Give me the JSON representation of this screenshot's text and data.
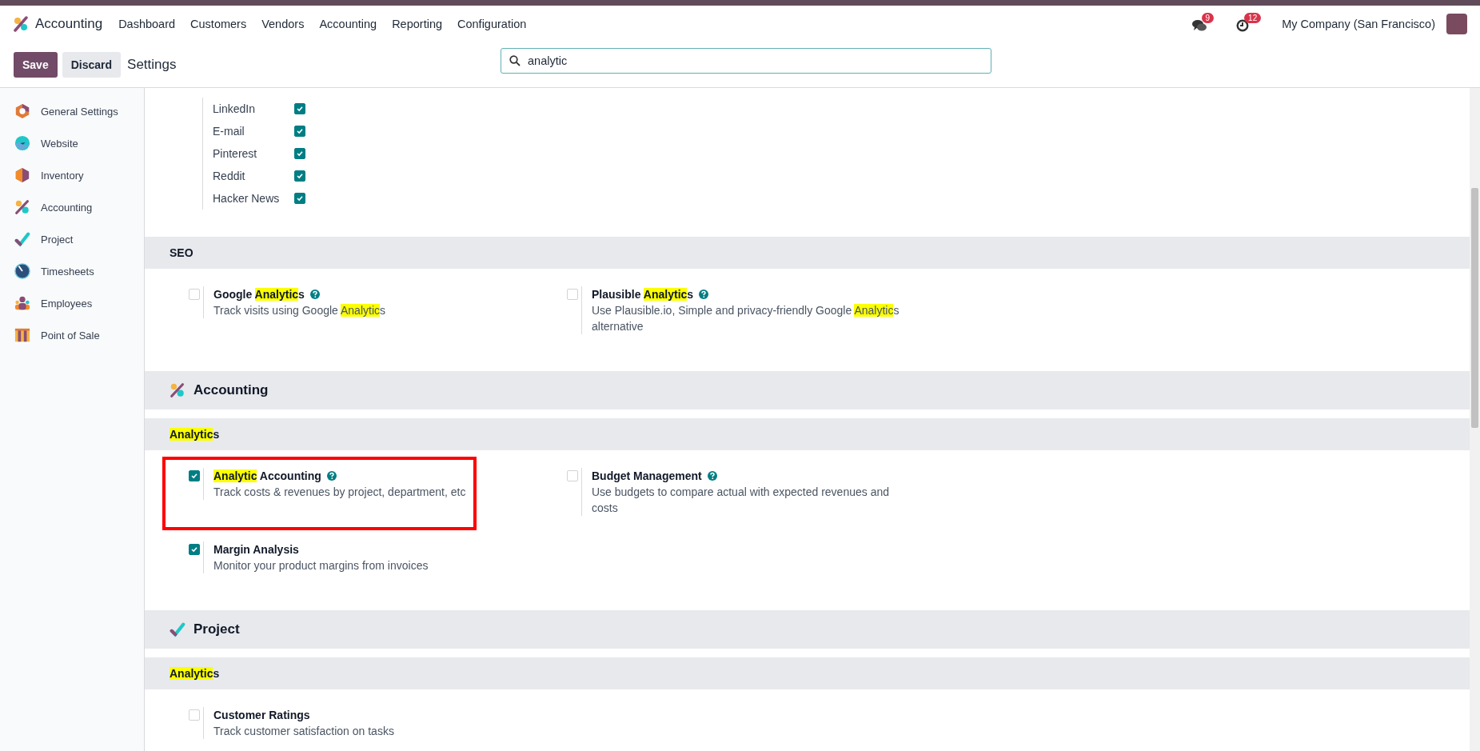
{
  "app": {
    "name": "Accounting"
  },
  "menu": [
    "Dashboard",
    "Customers",
    "Vendors",
    "Accounting",
    "Reporting",
    "Configuration"
  ],
  "systray": {
    "messages_count": "9",
    "activities_count": "12",
    "company": "My Company (San Francisco)"
  },
  "control_panel": {
    "save": "Save",
    "discard": "Discard",
    "breadcrumb": "Settings"
  },
  "search": {
    "value": "analytic"
  },
  "sidebar": {
    "items": [
      {
        "label": "General Settings",
        "kind": "general",
        "selected": false
      },
      {
        "label": "Website",
        "kind": "website",
        "selected": false
      },
      {
        "label": "Inventory",
        "kind": "inventory",
        "selected": false
      },
      {
        "label": "Accounting",
        "kind": "accounting",
        "selected": false
      },
      {
        "label": "Project",
        "kind": "project",
        "selected": false
      },
      {
        "label": "Timesheets",
        "kind": "timesheets",
        "selected": false
      },
      {
        "label": "Employees",
        "kind": "employees",
        "selected": false
      },
      {
        "label": "Point of Sale",
        "kind": "pos",
        "selected": false
      }
    ]
  },
  "share_networks": [
    {
      "label": "LinkedIn",
      "checked": true
    },
    {
      "label": "E-mail",
      "checked": true
    },
    {
      "label": "Pinterest",
      "checked": true
    },
    {
      "label": "Reddit",
      "checked": true
    },
    {
      "label": "Hacker News",
      "checked": true
    }
  ],
  "sections": [
    {
      "kind": "group",
      "title": [
        {
          "text": "SEO",
          "highlight": false
        }
      ],
      "settings": [
        {
          "title": [
            {
              "text": "Google ",
              "highlight": false
            },
            {
              "text": "Analytic",
              "highlight": true
            },
            {
              "text": "s",
              "highlight": false
            }
          ],
          "help": true,
          "checked": false,
          "outlined": false,
          "description": [
            {
              "text": "Track visits using Google ",
              "highlight": false
            },
            {
              "text": "Analytic",
              "highlight": true
            },
            {
              "text": "s",
              "highlight": false
            }
          ]
        },
        {
          "title": [
            {
              "text": "Plausible ",
              "highlight": false
            },
            {
              "text": "Analytic",
              "highlight": true
            },
            {
              "text": "s",
              "highlight": false
            }
          ],
          "help": true,
          "checked": false,
          "outlined": false,
          "description": [
            {
              "text": "Use Plausible.io, Simple and privacy-friendly Google ",
              "highlight": false
            },
            {
              "text": "Analytic",
              "highlight": true
            },
            {
              "text": "s alternative",
              "highlight": false
            }
          ]
        }
      ]
    },
    {
      "kind": "app_accounting",
      "title": [
        {
          "text": "Accounting",
          "highlight": false
        }
      ]
    },
    {
      "kind": "group",
      "title": [
        {
          "text": "Analytic",
          "highlight": true
        },
        {
          "text": "s",
          "highlight": false
        }
      ],
      "settings": [
        {
          "title": [
            {
              "text": "Analytic",
              "highlight": true
            },
            {
              "text": " Accounting",
              "highlight": false
            }
          ],
          "help": true,
          "checked": true,
          "outlined": true,
          "description": [
            {
              "text": "Track costs & revenues by project, department, etc",
              "highlight": false
            }
          ]
        },
        {
          "title": [
            {
              "text": "Budget Management",
              "highlight": false
            }
          ],
          "help": true,
          "checked": false,
          "outlined": false,
          "description": [
            {
              "text": "Use budgets to compare actual with expected revenues and costs",
              "highlight": false
            }
          ]
        },
        {
          "title": [
            {
              "text": "Margin Analysis",
              "highlight": false
            }
          ],
          "help": false,
          "checked": true,
          "outlined": false,
          "description": [
            {
              "text": "Monitor your product margins from invoices",
              "highlight": false
            }
          ]
        }
      ]
    },
    {
      "kind": "app_project",
      "title": [
        {
          "text": "Project",
          "highlight": false
        }
      ]
    },
    {
      "kind": "group",
      "title": [
        {
          "text": "Analytic",
          "highlight": true
        },
        {
          "text": "s",
          "highlight": false
        }
      ],
      "settings": [
        {
          "title": [
            {
              "text": "Customer Ratings",
              "highlight": false
            }
          ],
          "help": false,
          "checked": false,
          "outlined": false,
          "description": [
            {
              "text": "Track customer satisfaction on tasks",
              "highlight": false
            }
          ]
        }
      ]
    }
  ]
}
